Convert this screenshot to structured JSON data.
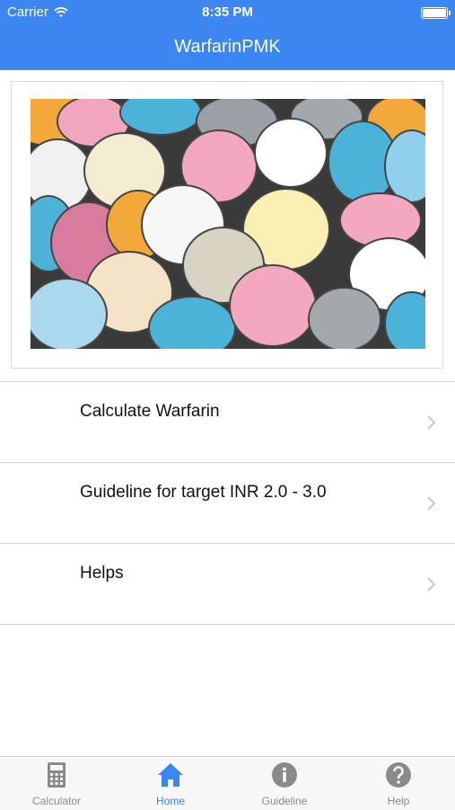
{
  "status_bar": {
    "carrier": "Carrier",
    "time": "8:35 PM"
  },
  "navbar": {
    "title": "WarfarinPMK"
  },
  "hero": {
    "image": "pills-photo"
  },
  "menu": {
    "items": [
      {
        "label": "Calculate Warfarin",
        "icon": "chevron-right-icon"
      },
      {
        "label": "Guideline for target INR 2.0 - 3.0",
        "icon": "chevron-right-icon"
      },
      {
        "label": "Helps",
        "icon": "chevron-right-icon"
      }
    ]
  },
  "tabbar": {
    "active": "Home",
    "tabs": [
      {
        "label": "Calculator",
        "icon": "calculator-icon"
      },
      {
        "label": "Home",
        "icon": "home-icon"
      },
      {
        "label": "Guideline",
        "icon": "info-icon"
      },
      {
        "label": "Help",
        "icon": "question-icon"
      }
    ]
  },
  "colors": {
    "accent": "#3b86f0",
    "tab_inactive": "#8a8a8a",
    "separator": "#d7d7d7"
  }
}
